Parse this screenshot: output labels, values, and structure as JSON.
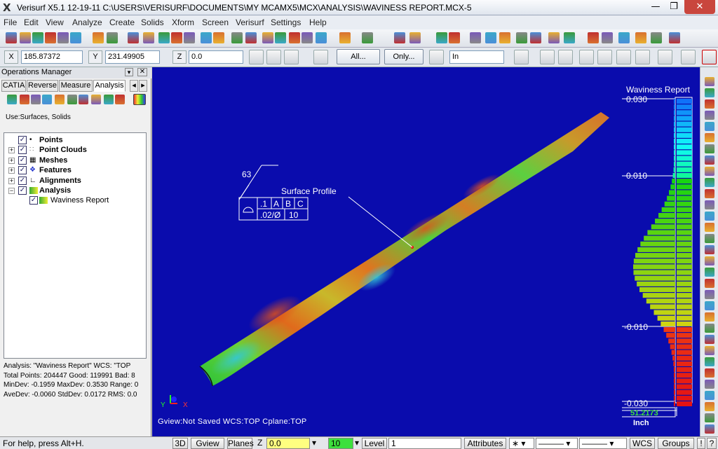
{
  "window": {
    "title": "Verisurf X5.1 12-19-11 C:\\USERS\\VERISURF\\DOCUMENTS\\MY MCAMX5\\MCX\\ANALYSIS\\WAVINESS REPORT.MCX-5",
    "app_icon": "X"
  },
  "menu": [
    "File",
    "Edit",
    "View",
    "Analyze",
    "Create",
    "Solids",
    "Xform",
    "Screen",
    "Verisurf",
    "Settings",
    "Help"
  ],
  "coords": {
    "x_label": "X",
    "x_value": "185.87372",
    "y_label": "Y",
    "y_value": "231.49905",
    "z_label": "Z",
    "z_value": "0.0",
    "all_label": "All...",
    "only_label": "Only...",
    "mode_value": "In"
  },
  "ops": {
    "title": "Operations Manager",
    "tabs": [
      "CATIA",
      "Reverse",
      "Measure",
      "Analysis"
    ],
    "use_text": "Use:Surfaces, Solids",
    "tree": [
      "Points",
      "Point Clouds",
      "Meshes",
      "Features",
      "Alignments",
      "Analysis",
      "Waviness Report"
    ],
    "stats": [
      "Analysis: \"Waviness Report\"    WCS: \"TOP",
      "Total Points: 204447 Good: 119991 Bad: 8",
      "MinDev: -0.1959 MaxDev: 0.3530 Range: 0",
      "AveDev: -0.0060 StdDev: 0.0172 RMS: 0.0"
    ]
  },
  "viewport": {
    "status": "Gview:Not Saved    WCS:TOP    Cplane:TOP",
    "gdt": {
      "angle": "63",
      "label": "Surface Profile",
      "tol1": ".1",
      "datum_a": "A",
      "datum_b": "B",
      "datum_c": "C",
      "tol2": ".02/Ø",
      "tol2_val": "10"
    },
    "wcs_x": "X",
    "wcs_y": "Y"
  },
  "waviness": {
    "title": "Waviness Report",
    "ticks": [
      "0.030",
      "0.010",
      "-0.010",
      "-0.030"
    ],
    "readout": "51.2173",
    "unit": "Inch"
  },
  "status": {
    "help": "For help, press Alt+H.",
    "btn_3d": "3D",
    "btn_gview": "Gview",
    "btn_planes": "Planes",
    "z_label": "Z",
    "z_value": "0.0",
    "level_value": "10",
    "level_label": "Level",
    "level_num": "1",
    "attributes": "Attributes",
    "wcs": "WCS",
    "groups": "Groups",
    "bang": "!",
    "help_q": "?"
  }
}
